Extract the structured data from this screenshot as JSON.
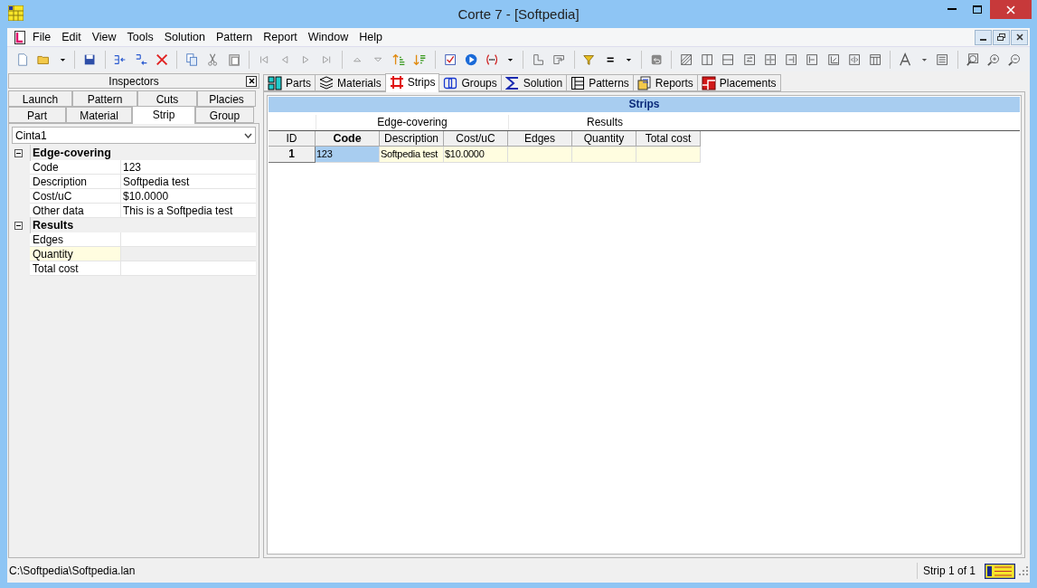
{
  "window": {
    "title": "Corte 7 - [Softpedia]"
  },
  "menu": [
    "File",
    "Edit",
    "View",
    "Tools",
    "Solution",
    "Pattern",
    "Report",
    "Window",
    "Help"
  ],
  "inspector": {
    "title": "Inspectors",
    "tab_rows": [
      [
        {
          "label": "Launch",
          "selected": false
        },
        {
          "label": "Pattern",
          "selected": false
        },
        {
          "label": "Cuts",
          "selected": false
        },
        {
          "label": "Placies",
          "selected": false
        }
      ],
      [
        {
          "label": "Part",
          "selected": false
        },
        {
          "label": "Material",
          "selected": false
        },
        {
          "label": "Strip",
          "selected": true
        },
        {
          "label": "Group",
          "selected": false
        }
      ]
    ],
    "selector": {
      "value": "Cinta1"
    },
    "groups": [
      {
        "label": "Edge-covering",
        "expanded": true,
        "properties": [
          {
            "name": "Code",
            "value": "123",
            "selected": false
          },
          {
            "name": "Description",
            "value": "Softpedia test",
            "selected": false
          },
          {
            "name": "Cost/uC",
            "value": "$10.0000",
            "selected": false
          },
          {
            "name": "Other data",
            "value": "This is a Softpedia test",
            "selected": false
          }
        ]
      },
      {
        "label": "Results",
        "expanded": true,
        "properties": [
          {
            "name": "Edges",
            "selected": false
          },
          {
            "name": "Quantity",
            "selected": true
          },
          {
            "name": "Total cost",
            "selected": false
          }
        ]
      }
    ]
  },
  "doc_tabs": [
    {
      "label": "Parts",
      "kind": "parts",
      "selected": false
    },
    {
      "label": "Materials",
      "kind": "materials",
      "selected": false
    },
    {
      "label": "Strips",
      "kind": "strips",
      "selected": true
    },
    {
      "label": "Groups",
      "kind": "groups",
      "selected": false
    },
    {
      "label": "Solution",
      "kind": "solution",
      "selected": false
    },
    {
      "label": "Patterns",
      "kind": "patterns",
      "selected": false
    },
    {
      "label": "Reports",
      "kind": "reports",
      "selected": false
    },
    {
      "label": "Placements",
      "kind": "placements",
      "selected": false
    }
  ],
  "grid": {
    "title": "Strips",
    "id_column": "ID",
    "column_groups": [
      {
        "label": "Edge-covering",
        "columns": [
          {
            "label": "Code",
            "selected": true
          },
          {
            "label": "Description",
            "selected": false
          },
          {
            "label": "Cost/uC",
            "selected": false
          }
        ]
      },
      {
        "label": "Results",
        "columns": [
          {
            "label": "Edges",
            "selected": false
          },
          {
            "label": "Quantity",
            "selected": false
          },
          {
            "label": "Total cost",
            "selected": false
          }
        ]
      }
    ],
    "rows": [
      {
        "id": "1",
        "cells": [
          {
            "text": "123",
            "selected": true
          },
          {
            "text": "Softpedia test",
            "selected": false
          },
          {
            "text": "$10.0000",
            "selected": false
          },
          {
            "selected": false
          },
          {
            "selected": false
          },
          {
            "selected": false
          }
        ]
      }
    ]
  },
  "status_bar": {
    "path": "C:\\Softpedia\\Softpedia.lan",
    "position": "Strip 1 of 1"
  }
}
